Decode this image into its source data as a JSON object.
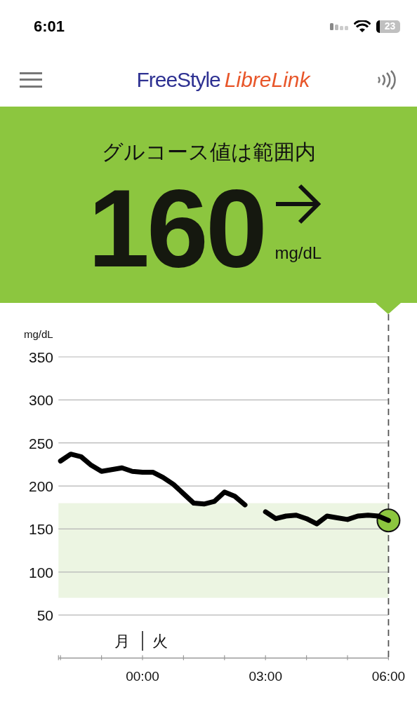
{
  "status_bar": {
    "time": "6:01",
    "battery": "23"
  },
  "header": {
    "logo_part_1": "FreeStyle",
    "logo_part_2": "LibreLink"
  },
  "banner": {
    "status": "グルコース値は範囲内",
    "value": "160",
    "unit": "mg/dL"
  },
  "chart": {
    "day_labels": [
      "月",
      "火"
    ],
    "chart_data": {
      "type": "line",
      "ylabel": "mg/dL",
      "grid": true,
      "xlim": [
        -2.05,
        6
      ],
      "ylim": [
        0,
        350
      ],
      "xticks": [
        {
          "value": 0,
          "label": "00:00"
        },
        {
          "value": 3,
          "label": "03:00"
        },
        {
          "value": 6,
          "label": "06:00"
        }
      ],
      "yticks": [
        50,
        100,
        150,
        200,
        250,
        300,
        350
      ],
      "x": [
        -2,
        -1.75,
        -1.5,
        -1.25,
        -1,
        -0.75,
        -0.5,
        -0.25,
        0,
        0.25,
        0.5,
        0.75,
        1,
        1.25,
        1.5,
        1.75,
        2,
        2.25,
        2.5,
        2.75,
        3,
        3.25,
        3.5,
        3.75,
        4,
        4.25,
        4.5,
        4.75,
        5,
        5.25,
        5.5,
        5.75,
        6
      ],
      "series": [
        {
          "color": "#000000",
          "values": [
            229,
            237,
            234,
            224,
            217,
            219,
            221,
            217,
            216,
            216,
            210,
            202,
            191,
            180,
            179,
            182,
            193,
            188,
            178,
            null,
            170,
            162,
            165,
            166,
            162,
            156,
            165,
            163,
            161,
            165,
            166,
            165,
            160
          ]
        }
      ],
      "bands": [
        {
          "axis": "y",
          "from": 70,
          "to": 180
        }
      ]
    }
  }
}
